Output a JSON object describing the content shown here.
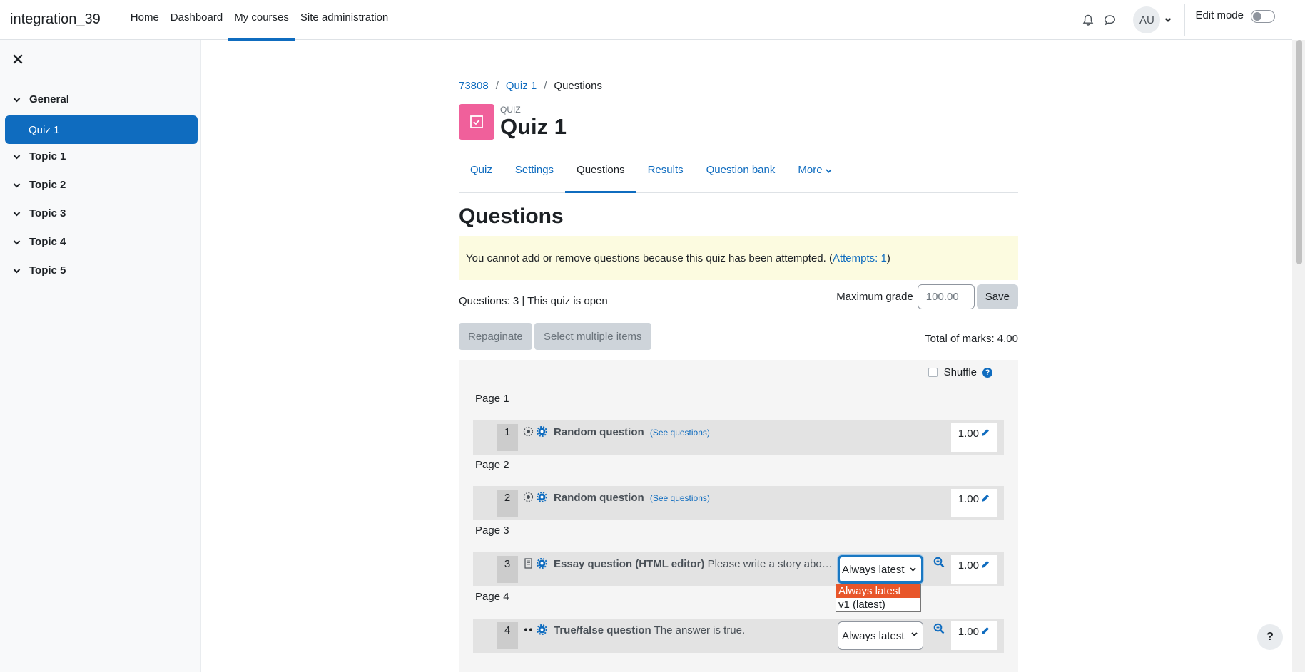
{
  "navbar": {
    "brand": "integration_39",
    "links": [
      "Home",
      "Dashboard",
      "My courses",
      "Site administration"
    ],
    "active_link": "My courses",
    "avatar_initials": "AU",
    "edit_mode_label": "Edit mode",
    "edit_mode_on": false
  },
  "drawer": {
    "sections": [
      "General",
      "Topic 1",
      "Topic 2",
      "Topic 3",
      "Topic 4",
      "Topic 5"
    ],
    "active_item": "Quiz 1"
  },
  "breadcrumb": [
    "73808",
    "Quiz 1",
    "Questions"
  ],
  "header": {
    "eyebrow": "QUIZ",
    "title": "Quiz 1",
    "icon_color": "#f0609b"
  },
  "tabs": [
    "Quiz",
    "Settings",
    "Questions",
    "Results",
    "Question bank",
    "More"
  ],
  "active_tab": "Questions",
  "page_title": "Questions",
  "alert": {
    "text": "You cannot add or remove questions because this quiz has been attempted. (",
    "link": "Attempts: 1",
    "close": ")"
  },
  "status_line": "Questions: 3 | This quiz is open",
  "max_grade": {
    "label": "Maximum grade",
    "value": "100.00",
    "save_label": "Save"
  },
  "buttons": {
    "repaginate": "Repaginate",
    "select_multiple": "Select multiple items"
  },
  "total_marks": "Total of marks: 4.00",
  "shuffle_label": "Shuffle",
  "shuffle_checked": false,
  "pages": [
    "Page 1",
    "Page 2",
    "Page 3",
    "Page 4"
  ],
  "slots": [
    {
      "num": "1",
      "name": "Random question",
      "link": "(See questions)",
      "desc": "",
      "mark": "1.00"
    },
    {
      "num": "2",
      "name": "Random question",
      "link": "(See questions)",
      "desc": "",
      "mark": "1.00"
    },
    {
      "num": "3",
      "name": "Essay question (HTML editor)",
      "link": "",
      "desc": "Please write a story abo…",
      "mark": "1.00",
      "version": "Always latest"
    },
    {
      "num": "4",
      "name": "True/false question",
      "link": "",
      "desc": "The answer is true.",
      "mark": "1.00",
      "version": "Always latest"
    }
  ],
  "version_options": [
    "Always latest",
    "v1 (latest)"
  ],
  "help_button": "?",
  "colors": {
    "primary": "#0f6cbf",
    "alert_bg": "#fcfbe0",
    "dropdown_highlight": "#e8562a"
  }
}
